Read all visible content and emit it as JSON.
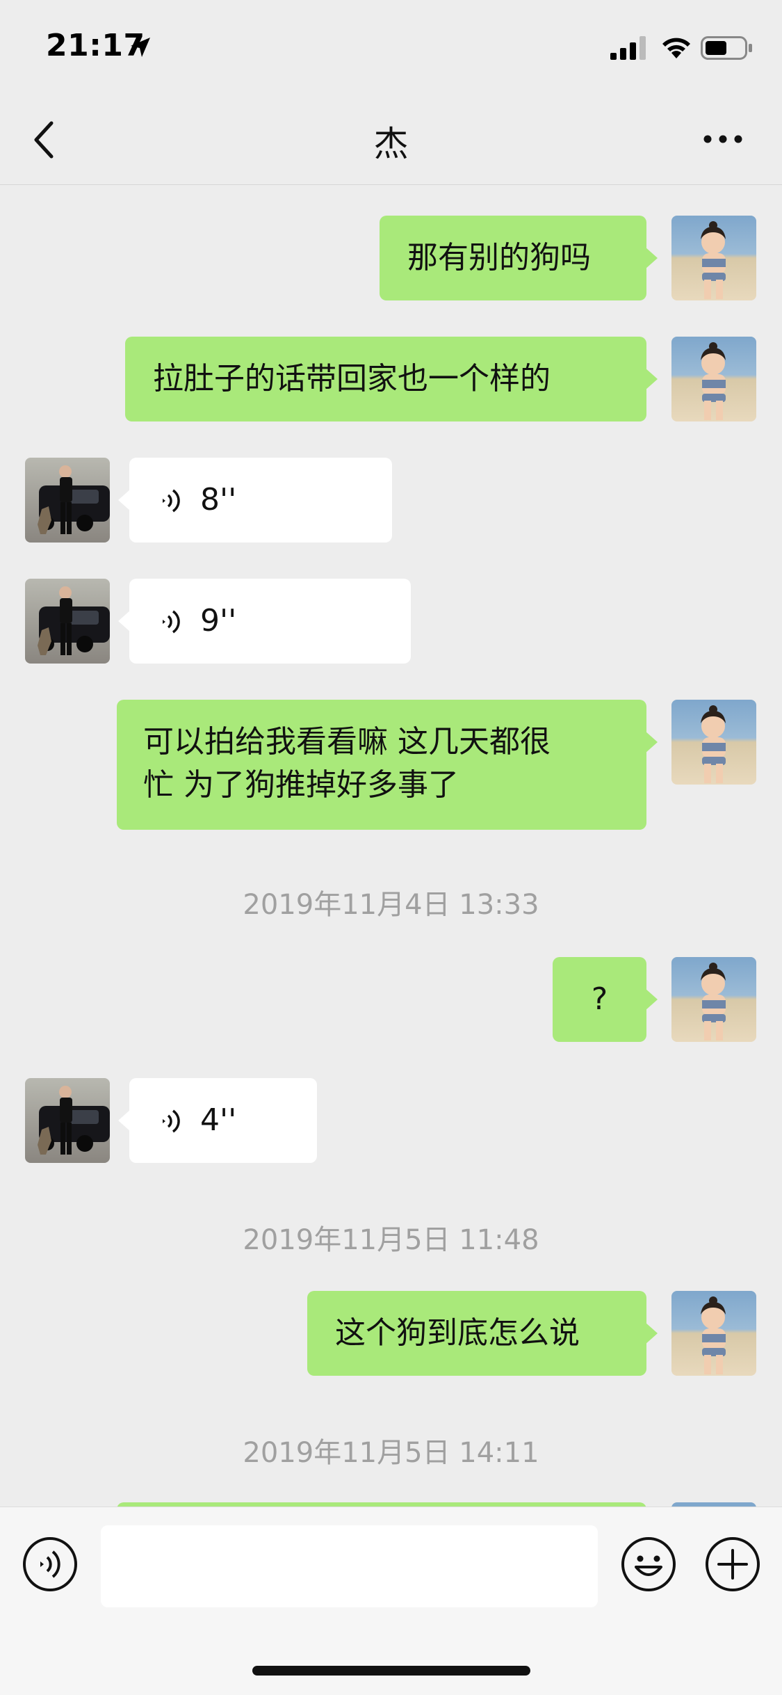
{
  "status": {
    "time": "21:17"
  },
  "header": {
    "title": "杰"
  },
  "messages": [
    {
      "side": "right",
      "text": "那有别的狗吗"
    },
    {
      "side": "right",
      "text": "拉肚子的话带回家也一个样的"
    },
    {
      "side": "left",
      "voice_duration": "8''"
    },
    {
      "side": "left",
      "voice_duration": "9''"
    },
    {
      "side": "right",
      "lines": [
        "可以拍给我看看嘛 这几天都很",
        "忙 为了狗推掉好多事了"
      ]
    },
    {
      "side": "right",
      "text": "?"
    },
    {
      "side": "left",
      "voice_duration": "4''"
    },
    {
      "side": "right",
      "text": "这个狗到底怎么说"
    }
  ],
  "timestamps": [
    "2019年11月4日 13:33",
    "2019年11月5日 11:48",
    "2019年11月5日 14:11"
  ],
  "input": {
    "value": ""
  },
  "icons": {
    "back": "back-chevron-icon",
    "more": "more-dots-icon",
    "voice": "voice-toggle-icon",
    "emoji": "emoji-icon",
    "plus": "plus-icon"
  },
  "colors": {
    "background": "#ededed",
    "self_bubble": "#a9e97a",
    "other_bubble": "#ffffff",
    "timestamp": "#a0a0a0"
  }
}
